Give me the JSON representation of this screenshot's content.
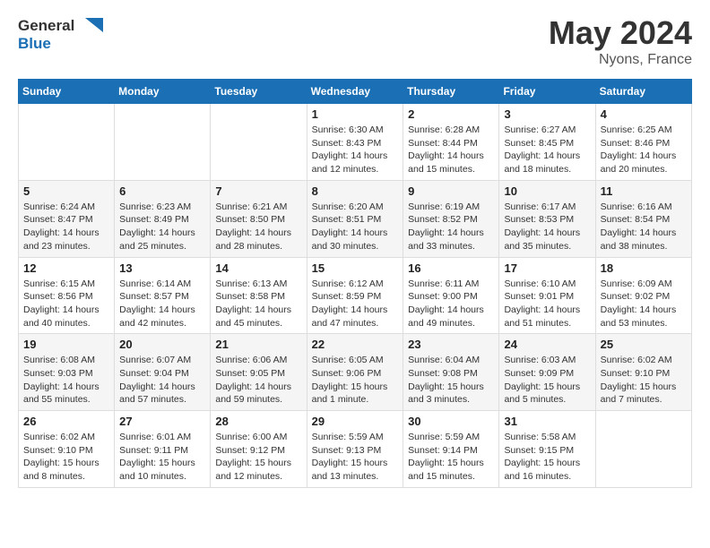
{
  "header": {
    "logo_general": "General",
    "logo_blue": "Blue",
    "title": "May 2024",
    "location": "Nyons, France"
  },
  "weekdays": [
    "Sunday",
    "Monday",
    "Tuesday",
    "Wednesday",
    "Thursday",
    "Friday",
    "Saturday"
  ],
  "weeks": [
    [
      {
        "day": "",
        "info": ""
      },
      {
        "day": "",
        "info": ""
      },
      {
        "day": "",
        "info": ""
      },
      {
        "day": "1",
        "info": "Sunrise: 6:30 AM\nSunset: 8:43 PM\nDaylight: 14 hours and 12 minutes."
      },
      {
        "day": "2",
        "info": "Sunrise: 6:28 AM\nSunset: 8:44 PM\nDaylight: 14 hours and 15 minutes."
      },
      {
        "day": "3",
        "info": "Sunrise: 6:27 AM\nSunset: 8:45 PM\nDaylight: 14 hours and 18 minutes."
      },
      {
        "day": "4",
        "info": "Sunrise: 6:25 AM\nSunset: 8:46 PM\nDaylight: 14 hours and 20 minutes."
      }
    ],
    [
      {
        "day": "5",
        "info": "Sunrise: 6:24 AM\nSunset: 8:47 PM\nDaylight: 14 hours and 23 minutes."
      },
      {
        "day": "6",
        "info": "Sunrise: 6:23 AM\nSunset: 8:49 PM\nDaylight: 14 hours and 25 minutes."
      },
      {
        "day": "7",
        "info": "Sunrise: 6:21 AM\nSunset: 8:50 PM\nDaylight: 14 hours and 28 minutes."
      },
      {
        "day": "8",
        "info": "Sunrise: 6:20 AM\nSunset: 8:51 PM\nDaylight: 14 hours and 30 minutes."
      },
      {
        "day": "9",
        "info": "Sunrise: 6:19 AM\nSunset: 8:52 PM\nDaylight: 14 hours and 33 minutes."
      },
      {
        "day": "10",
        "info": "Sunrise: 6:17 AM\nSunset: 8:53 PM\nDaylight: 14 hours and 35 minutes."
      },
      {
        "day": "11",
        "info": "Sunrise: 6:16 AM\nSunset: 8:54 PM\nDaylight: 14 hours and 38 minutes."
      }
    ],
    [
      {
        "day": "12",
        "info": "Sunrise: 6:15 AM\nSunset: 8:56 PM\nDaylight: 14 hours and 40 minutes."
      },
      {
        "day": "13",
        "info": "Sunrise: 6:14 AM\nSunset: 8:57 PM\nDaylight: 14 hours and 42 minutes."
      },
      {
        "day": "14",
        "info": "Sunrise: 6:13 AM\nSunset: 8:58 PM\nDaylight: 14 hours and 45 minutes."
      },
      {
        "day": "15",
        "info": "Sunrise: 6:12 AM\nSunset: 8:59 PM\nDaylight: 14 hours and 47 minutes."
      },
      {
        "day": "16",
        "info": "Sunrise: 6:11 AM\nSunset: 9:00 PM\nDaylight: 14 hours and 49 minutes."
      },
      {
        "day": "17",
        "info": "Sunrise: 6:10 AM\nSunset: 9:01 PM\nDaylight: 14 hours and 51 minutes."
      },
      {
        "day": "18",
        "info": "Sunrise: 6:09 AM\nSunset: 9:02 PM\nDaylight: 14 hours and 53 minutes."
      }
    ],
    [
      {
        "day": "19",
        "info": "Sunrise: 6:08 AM\nSunset: 9:03 PM\nDaylight: 14 hours and 55 minutes."
      },
      {
        "day": "20",
        "info": "Sunrise: 6:07 AM\nSunset: 9:04 PM\nDaylight: 14 hours and 57 minutes."
      },
      {
        "day": "21",
        "info": "Sunrise: 6:06 AM\nSunset: 9:05 PM\nDaylight: 14 hours and 59 minutes."
      },
      {
        "day": "22",
        "info": "Sunrise: 6:05 AM\nSunset: 9:06 PM\nDaylight: 15 hours and 1 minute."
      },
      {
        "day": "23",
        "info": "Sunrise: 6:04 AM\nSunset: 9:08 PM\nDaylight: 15 hours and 3 minutes."
      },
      {
        "day": "24",
        "info": "Sunrise: 6:03 AM\nSunset: 9:09 PM\nDaylight: 15 hours and 5 minutes."
      },
      {
        "day": "25",
        "info": "Sunrise: 6:02 AM\nSunset: 9:10 PM\nDaylight: 15 hours and 7 minutes."
      }
    ],
    [
      {
        "day": "26",
        "info": "Sunrise: 6:02 AM\nSunset: 9:10 PM\nDaylight: 15 hours and 8 minutes."
      },
      {
        "day": "27",
        "info": "Sunrise: 6:01 AM\nSunset: 9:11 PM\nDaylight: 15 hours and 10 minutes."
      },
      {
        "day": "28",
        "info": "Sunrise: 6:00 AM\nSunset: 9:12 PM\nDaylight: 15 hours and 12 minutes."
      },
      {
        "day": "29",
        "info": "Sunrise: 5:59 AM\nSunset: 9:13 PM\nDaylight: 15 hours and 13 minutes."
      },
      {
        "day": "30",
        "info": "Sunrise: 5:59 AM\nSunset: 9:14 PM\nDaylight: 15 hours and 15 minutes."
      },
      {
        "day": "31",
        "info": "Sunrise: 5:58 AM\nSunset: 9:15 PM\nDaylight: 15 hours and 16 minutes."
      },
      {
        "day": "",
        "info": ""
      }
    ]
  ]
}
